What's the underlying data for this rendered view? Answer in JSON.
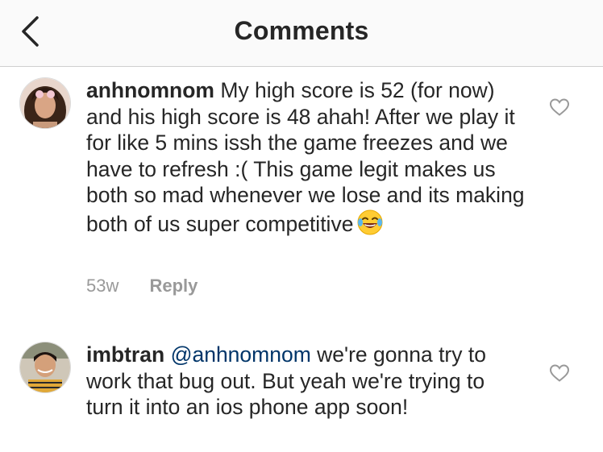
{
  "header": {
    "title": "Comments",
    "back_icon": "chevron-left-icon"
  },
  "comments": [
    {
      "username": "anhnomnom",
      "mention": "",
      "text": "My high score is 52 (for now) and his high score is 48 ahah! After we play it for like 5 mins issh the game freezes and we have to refresh :( This game legit makes us both so mad whenever we lose and its making both of us super competitive",
      "emoji": "face-with-tears-of-joy",
      "time": "53w",
      "reply_label": "Reply",
      "like_icon": "heart-outline-icon"
    },
    {
      "username": "imbtran",
      "mention": "@anhnomnom",
      "text": "we're gonna try to work that bug out. But yeah we're trying to turn it into an ios phone app soon!",
      "like_icon": "heart-outline-icon"
    }
  ],
  "colors": {
    "text": "#262626",
    "secondary": "#999999",
    "mention": "#003569",
    "header_bg": "#fafafa",
    "divider": "#cfcfcf"
  }
}
